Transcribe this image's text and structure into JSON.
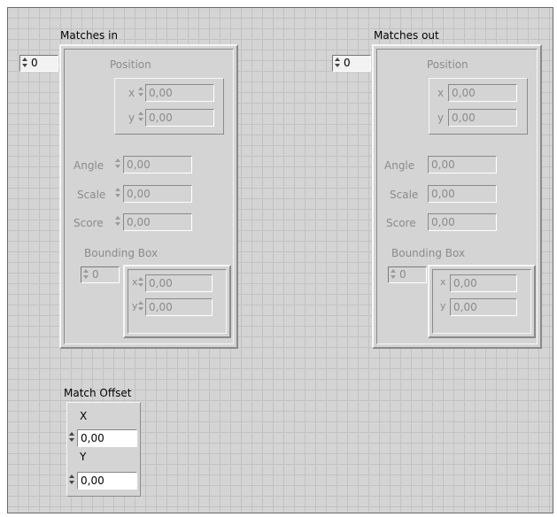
{
  "matches_in": {
    "label": "Matches in",
    "index": "0",
    "position": {
      "label": "Position",
      "x_label": "x",
      "x_value": "0,00",
      "y_label": "y",
      "y_value": "0,00"
    },
    "angle": {
      "label": "Angle",
      "value": "0,00"
    },
    "scale": {
      "label": "Scale",
      "value": "0,00"
    },
    "score": {
      "label": "Score",
      "value": "0,00"
    },
    "bounding_box": {
      "label": "Bounding Box",
      "index": "0",
      "x_label": "x",
      "x_value": "0,00",
      "y_label": "y",
      "y_value": "0,00"
    }
  },
  "matches_out": {
    "label": "Matches out",
    "index": "0",
    "position": {
      "label": "Position",
      "x_label": "x",
      "x_value": "0,00",
      "y_label": "y",
      "y_value": "0,00"
    },
    "angle": {
      "label": "Angle",
      "value": "0,00"
    },
    "scale": {
      "label": "Scale",
      "value": "0,00"
    },
    "score": {
      "label": "Score",
      "value": "0,00"
    },
    "bounding_box": {
      "label": "Bounding Box",
      "index": "0",
      "x_label": "x",
      "x_value": "0,00",
      "y_label": "y",
      "y_value": "0,00"
    }
  },
  "match_offset": {
    "label": "Match Offset",
    "x_label": "X",
    "x_value": "0,00",
    "y_label": "Y",
    "y_value": "0,00"
  }
}
